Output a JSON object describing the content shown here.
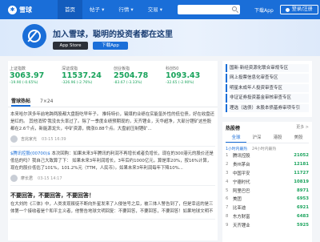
{
  "header": {
    "logo_text": "雪球",
    "nav": [
      "首页",
      "帖子 ▾",
      "行情 ▾",
      "交易 ▾"
    ],
    "download": "下载App",
    "login": "登录/注册"
  },
  "banner": {
    "slogan": "加入雪球，聪明的投资者都在这里",
    "btn_ios": "App Store",
    "btn_android": "下载App"
  },
  "quotes": [
    {
      "name": "上证指数",
      "value": "3063.97",
      "change": "-19.90 (-0.65%)"
    },
    {
      "name": "深证成指",
      "value": "11537.24",
      "change": "-326.96 (-2.76%)"
    },
    {
      "name": "创业板指",
      "value": "2504.78",
      "change": "-83.67 (-3.33%)"
    },
    {
      "name": "科创50",
      "value": "1093.43",
      "change": "-32.65 (-2.90%)"
    }
  ],
  "tabs": [
    "雪球热帖",
    "7×24"
  ],
  "posts": [
    {
      "text": "本来哈尔滨多年前地跨两股都大盘股吃早年子。 推特特价，锡煤的业绩在实能氢外性的低位债，好在收盘还是红的。 其他消转'我没去头率过了。除了一季度业绩预期现的，天齐锂业，天华超净，大部分锂矿这些股都在2.6个点，新能源龙头，中矿资源，微涨0.88个点。大盘前压制锂矿...",
      "author": "吉兆家光",
      "time": "03-15 16:39"
    },
    {
      "link": "$腾讯控股(00700)$",
      "text": "本次回购：如果未来3年腾讯的利润不再增长或者负增长，现在的300港元的股价还是低估的吗？我自己大致算了下： 如果未来3年利润增长，3年后约1000亿元，算是率20%，按16%计算，现在的股价低估了101%，101.2%元（TTM，人民币）。如果未来3年利润每年下降10%...",
      "author": "摩长君",
      "time": "03-15 14:17"
    },
    {
      "title": "不要回答，不要回答，不要回答！",
      "text": "在大刘的《三体》中，人类发现叛徒不断向外星发来了入侵信号之后，被三体人警告到了，但是幸运的是三体第一个接收者是个和平主义者，他警告地球文明回复：不要回答，不要回答，不要回答！如果地球文明不回复，人类就不会被三体人发现..."
    }
  ],
  "side_links": [
    "国新·新经资源化联合审规专区",
    "网上投票信息化审查专区",
    "明星未成年人投资审查专区",
    "非证证券投资基金审核审查专区",
    "理选（选债）未股本债基券审项专引"
  ],
  "hot": {
    "title": "热股榜",
    "more": "更多 >",
    "tabs": [
      "全球",
      "沪深",
      "港股",
      "美股"
    ],
    "subtabs": [
      "1小时内最热",
      "24小时内最热"
    ],
    "rows": [
      {
        "name": "腾讯控股",
        "value": "21052"
      },
      {
        "name": "贵州茅台",
        "value": "12181"
      },
      {
        "name": "中国平安",
        "value": "11727"
      },
      {
        "name": "宁德时代",
        "value": "10819"
      },
      {
        "name": "阿里巴巴",
        "value": "8971"
      },
      {
        "name": "美团",
        "value": "6953"
      },
      {
        "name": "比亚迪",
        "value": "6921"
      },
      {
        "name": "东方财富",
        "value": "6483"
      },
      {
        "name": "天齐锂业",
        "value": "5925"
      }
    ]
  }
}
